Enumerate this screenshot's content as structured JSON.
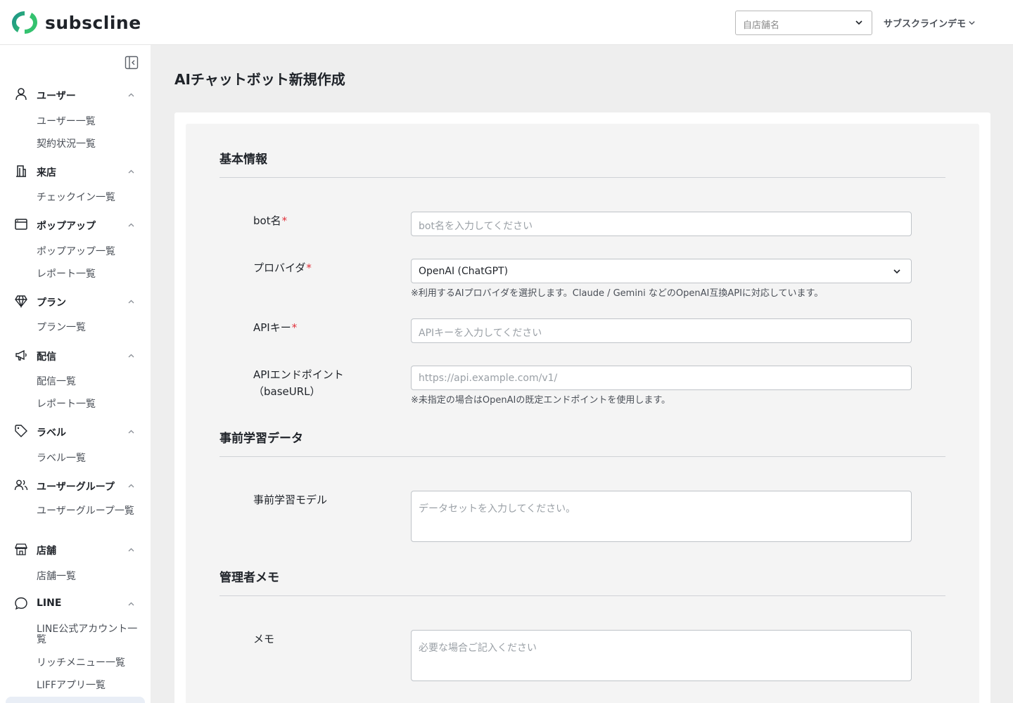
{
  "header": {
    "brand": "subscline",
    "store_placeholder": "自店舗名",
    "account_name": "サブスクラインデモ"
  },
  "sidebar": {
    "groups": [
      {
        "label": "ユーザー",
        "icon": "user-icon",
        "items": [
          "ユーザー一覧",
          "契約状況一覧"
        ]
      },
      {
        "label": "来店",
        "icon": "building-icon",
        "items": [
          "チェックイン一覧"
        ]
      },
      {
        "label": "ポップアップ",
        "icon": "window-icon",
        "items": [
          "ポップアップ一覧",
          "レポート一覧"
        ]
      },
      {
        "label": "プラン",
        "icon": "diamond-icon",
        "items": [
          "プラン一覧"
        ]
      },
      {
        "label": "配信",
        "icon": "megaphone-icon",
        "items": [
          "配信一覧",
          "レポート一覧"
        ]
      },
      {
        "label": "ラベル",
        "icon": "tag-icon",
        "items": [
          "ラベル一覧"
        ]
      },
      {
        "label": "ユーザーグループ",
        "icon": "users-icon",
        "items": [
          "ユーザーグループ一覧"
        ]
      },
      {
        "label": "店舗",
        "icon": "store-icon",
        "items": [
          "店舗一覧"
        ]
      },
      {
        "label": "LINE",
        "icon": "chat-bubble-icon",
        "items": [
          "LINE公式アカウント一覧",
          "リッチメニュー一覧",
          "LIFFアプリ一覧"
        ]
      }
    ]
  },
  "main": {
    "title": "AIチャットボット新規作成",
    "sections": {
      "basic": {
        "title": "基本情報",
        "bot_name": {
          "label": "bot名",
          "required": "*",
          "placeholder": "bot名を入力してください"
        },
        "provider": {
          "label": "プロバイダ",
          "required": "*",
          "value": "OpenAI (ChatGPT)",
          "hint": "※利用するAIプロバイダを選択します。Claude / Gemini などのOpenAI互換APIに対応しています。"
        },
        "api_key": {
          "label": "APIキー",
          "required": "*",
          "placeholder": "APIキーを入力してください"
        },
        "endpoint": {
          "label_line1": "APIエンドポイント",
          "label_line2": "（baseURL）",
          "placeholder": "https://api.example.com/v1/",
          "hint": "※未指定の場合はOpenAIの既定エンドポイントを使用します。"
        }
      },
      "pretraining": {
        "title": "事前学習データ",
        "model": {
          "label": "事前学習モデル",
          "placeholder": "データセットを入力してください。"
        }
      },
      "admin": {
        "title": "管理者メモ",
        "memo": {
          "label": "メモ",
          "placeholder": "必要な場合ご記入ください"
        }
      }
    }
  },
  "colors": {
    "required": "#e0303a",
    "logo_green": "#2bb673",
    "logo_teal": "#1a8c8c",
    "active_item_bg": "#e9eef6"
  }
}
